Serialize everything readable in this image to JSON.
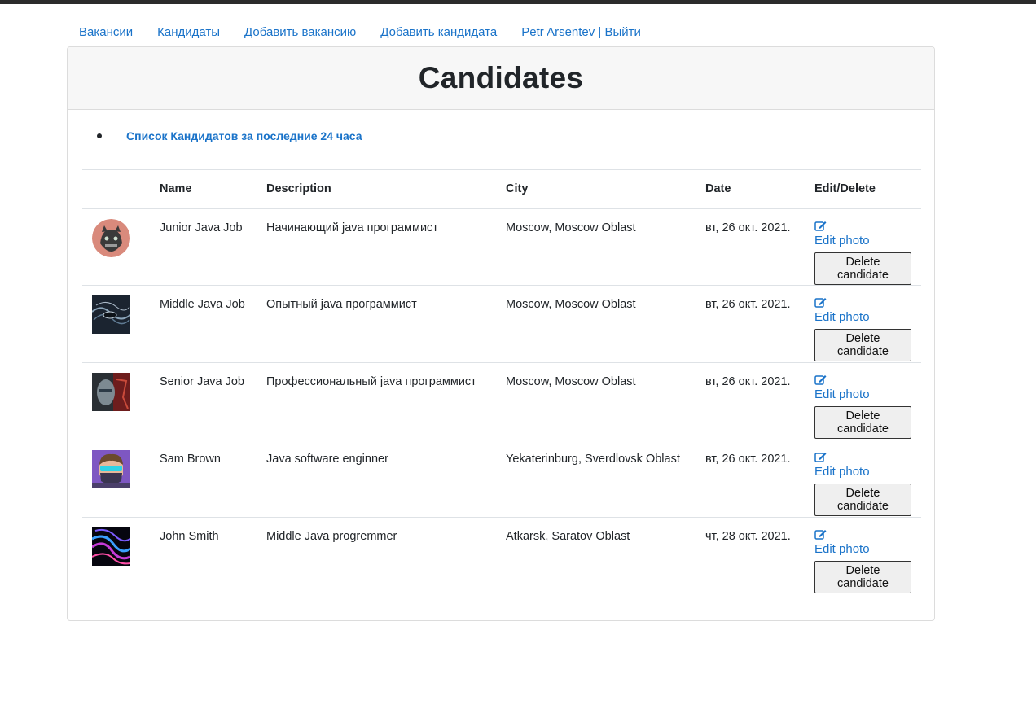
{
  "nav": {
    "vacancies": "Вакансии",
    "candidates": "Кандидаты",
    "add_vacancy": "Добавить вакансию",
    "add_candidate": "Добавить кандидата",
    "user_logout": "Petr Arsentev | Выйти"
  },
  "page": {
    "title": "Candidates",
    "recent_link": "Список Кандидатов за последние 24 часа"
  },
  "table": {
    "headers": [
      "",
      "Name",
      "Description",
      "City",
      "Date",
      "Edit/Delete"
    ],
    "rows": [
      {
        "name": "Junior Java Job",
        "description": "Начинающий java программист",
        "city": "Moscow, Moscow Oblast",
        "date": "вт, 26 окт. 2021.",
        "edit_label": "Edit photo",
        "delete_label": "Delete candidate"
      },
      {
        "name": "Middle Java Job",
        "description": "Опытный java программист",
        "city": "Moscow, Moscow Oblast",
        "date": "вт, 26 окт. 2021.",
        "edit_label": "Edit photo",
        "delete_label": "Delete candidate"
      },
      {
        "name": "Senior Java Job",
        "description": "Профессиональный java программист",
        "city": "Moscow, Moscow Oblast",
        "date": "вт, 26 окт. 2021.",
        "edit_label": "Edit photo",
        "delete_label": "Delete candidate"
      },
      {
        "name": "Sam Brown",
        "description": "Java software enginner",
        "city": "Yekaterinburg, Sverdlovsk Oblast",
        "date": "вт, 26 окт. 2021.",
        "edit_label": "Edit photo",
        "delete_label": "Delete candidate"
      },
      {
        "name": "John Smith",
        "description": "Middle Java progremmer",
        "city": "Atkarsk, Saratov Oblast",
        "date": "чт, 28 окт. 2021.",
        "edit_label": "Edit photo",
        "delete_label": "Delete candidate"
      }
    ]
  },
  "colors": {
    "link": "#1a73c9",
    "header_bg": "#f7f7f7",
    "border": "#dee2e6"
  },
  "icons": {
    "edit": "edit-square-icon"
  }
}
